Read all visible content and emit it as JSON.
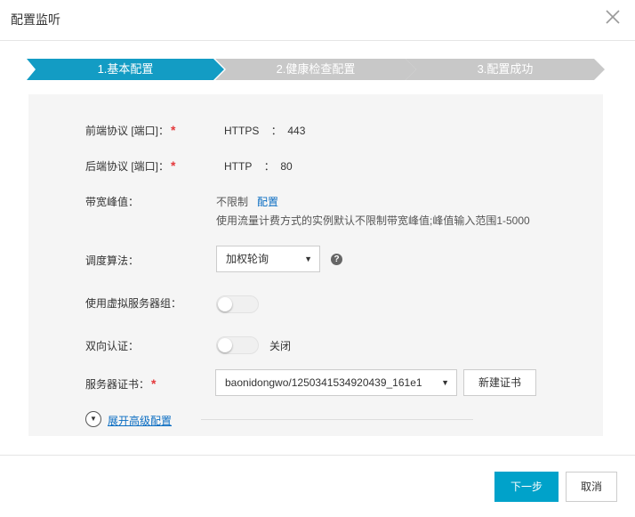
{
  "dialog": {
    "title": "配置监听"
  },
  "steps": [
    {
      "label": "1.基本配置",
      "active": true
    },
    {
      "label": "2.健康检查配置",
      "active": false
    },
    {
      "label": "3.配置成功",
      "active": false
    }
  ],
  "colors": {
    "step_active": "#139cc4",
    "step_inactive": "#c8c8c8",
    "primary": "#00a2ca",
    "link": "#0a6dc2",
    "required": "#e4393c"
  },
  "form": {
    "frontend": {
      "label": "前端协议 [端口]：",
      "required": "*",
      "protocol": "HTTPS",
      "sep": "：",
      "port": "443"
    },
    "backend": {
      "label": "后端协议 [端口]：",
      "required": "*",
      "protocol": "HTTP",
      "sep": "：",
      "port": "80"
    },
    "bandwidth": {
      "label": "带宽峰值：",
      "value": "不限制",
      "link": "配置",
      "hint": "使用流量计费方式的实例默认不限制带宽峰值;峰值输入范围1-5000"
    },
    "scheduler": {
      "label": "调度算法：",
      "selected": "加权轮询"
    },
    "vserver_group": {
      "label": "使用虚拟服务器组：",
      "on": false
    },
    "mutual_auth": {
      "label": "双向认证：",
      "on": false,
      "state_text": "关闭"
    },
    "server_cert": {
      "label": "服务器证书：",
      "required": "*",
      "selected": "baonidongwo/1250341534920439_161e1",
      "new_button": "新建证书"
    },
    "advanced": {
      "label": "展开高级配置"
    }
  },
  "footer": {
    "next": "下一步",
    "cancel": "取消"
  }
}
